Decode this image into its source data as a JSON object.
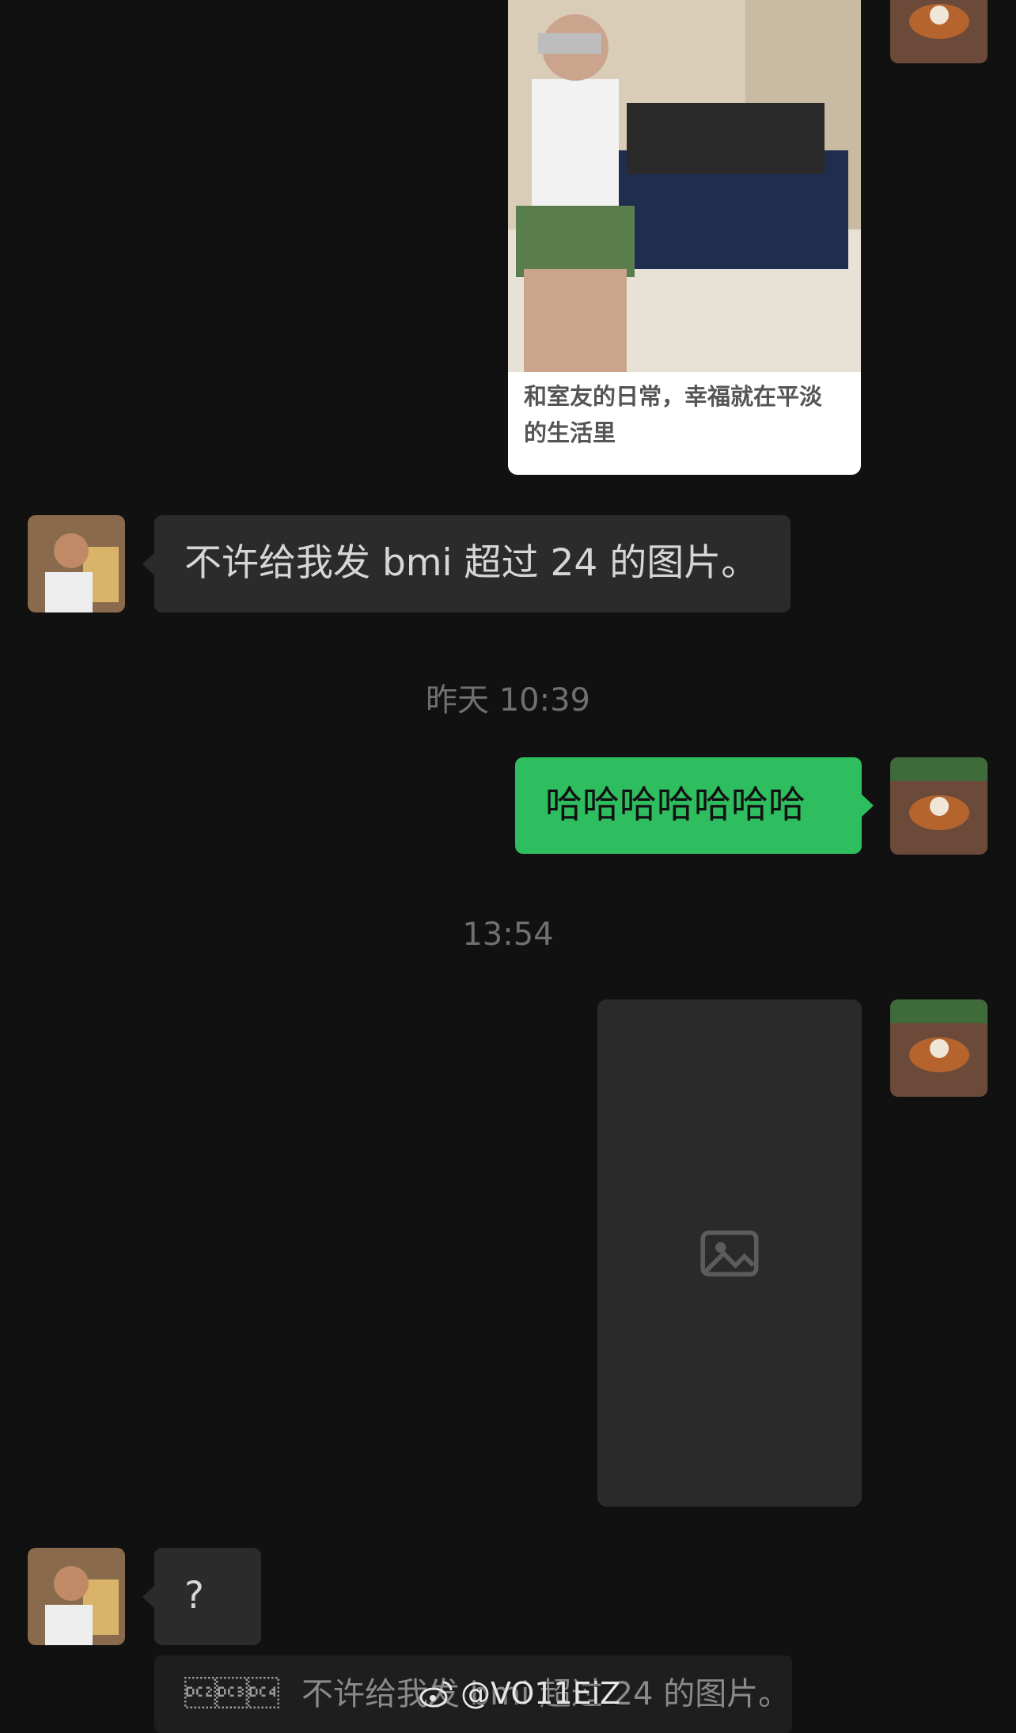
{
  "messages": {
    "photo_card_caption": "和室友的日常，幸福就在平淡的生活里",
    "msg_bmi": "不许给我发 bmi 超过 24 的图片。",
    "timestamp_1": "昨天 10:39",
    "msg_haha": "哈哈哈哈哈哈哈",
    "timestamp_2": "13:54",
    "msg_question": "?",
    "quote_prefix": "\u0012\u0013\u0014",
    "quote_text": "不许给我发 bmi 超过 24 的图片。"
  },
  "watermark": {
    "handle": "@VO11EiZ",
    "icon": "weibo-icon"
  },
  "colors": {
    "background": "#111111",
    "incoming_bubble": "#2b2b2b",
    "outgoing_bubble": "#2ebd5f",
    "timestamp": "#707070"
  }
}
